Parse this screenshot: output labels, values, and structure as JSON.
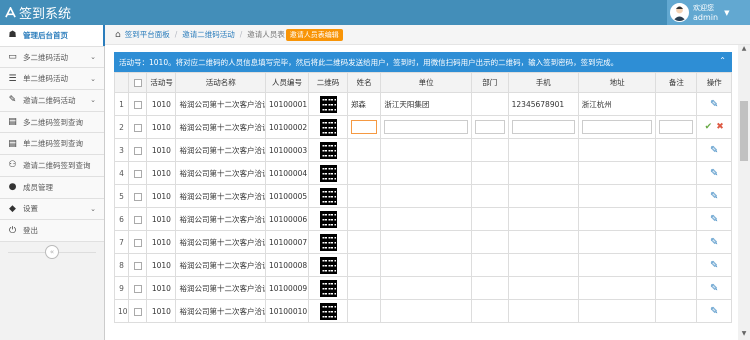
{
  "app": {
    "title": "签到系统",
    "logo_icon": "leaf-icon"
  },
  "user": {
    "greeting": "欢迎您",
    "name": "admin"
  },
  "sidebar": {
    "items": [
      {
        "label": "管理后台首页",
        "icon": "dashboard-icon",
        "active": true
      },
      {
        "label": "多二维码活动",
        "icon": "desktop-icon",
        "has_arrow": true
      },
      {
        "label": "单二维码活动",
        "icon": "list-icon",
        "has_arrow": true
      },
      {
        "label": "邀请二维码活动",
        "icon": "edit-icon",
        "has_arrow": true
      },
      {
        "label": "多二维码签到查询",
        "icon": "list-alt-icon"
      },
      {
        "label": "单二维码签到查询",
        "icon": "list-alt-icon"
      },
      {
        "label": "邀请二维码签到查询",
        "icon": "users-icon"
      },
      {
        "label": "成员管理",
        "icon": "user-icon"
      },
      {
        "label": "设置",
        "icon": "tag-icon",
        "has_arrow": true
      },
      {
        "label": "登出",
        "icon": "power-icon"
      }
    ],
    "collapse_icon": "double-chevron-left-icon"
  },
  "breadcrumb": {
    "items": [
      "签到平台面板",
      "邀请二维码活动",
      "邀请人员表"
    ],
    "tag": "邀请人员表编辑"
  },
  "alert": {
    "text": "活动号：1010。将对应二维码的人员信息填写完毕，然后将此二维码发送给用户，签到时，用微信扫码用户出示的二维码，输入签到密码，签到完成。"
  },
  "table": {
    "headers": [
      "活动号",
      "活动名称",
      "人员编号",
      "二维码",
      "姓名",
      "单位",
      "部门",
      "手机",
      "地址",
      "备注",
      "操作"
    ],
    "rows": [
      {
        "n": "1",
        "activity_id": "1010",
        "activity_name": "裕润公司第十二次客户洽谈会",
        "person_id": "10100001",
        "name": "郑森",
        "unit": "浙江天阳集团",
        "dept": "",
        "phone": "12345678901",
        "address": "浙江杭州",
        "note": "",
        "mode": "view"
      },
      {
        "n": "2",
        "activity_id": "1010",
        "activity_name": "裕润公司第十二次客户洽谈会",
        "person_id": "10100002",
        "name": "",
        "unit": "",
        "dept": "",
        "phone": "",
        "address": "",
        "note": "",
        "mode": "edit"
      },
      {
        "n": "3",
        "activity_id": "1010",
        "activity_name": "裕润公司第十二次客户洽谈会",
        "person_id": "10100003",
        "name": "",
        "unit": "",
        "dept": "",
        "phone": "",
        "address": "",
        "note": "",
        "mode": "view"
      },
      {
        "n": "4",
        "activity_id": "1010",
        "activity_name": "裕润公司第十二次客户洽谈会",
        "person_id": "10100004",
        "name": "",
        "unit": "",
        "dept": "",
        "phone": "",
        "address": "",
        "note": "",
        "mode": "view"
      },
      {
        "n": "5",
        "activity_id": "1010",
        "activity_name": "裕润公司第十二次客户洽谈会",
        "person_id": "10100005",
        "name": "",
        "unit": "",
        "dept": "",
        "phone": "",
        "address": "",
        "note": "",
        "mode": "view"
      },
      {
        "n": "6",
        "activity_id": "1010",
        "activity_name": "裕润公司第十二次客户洽谈会",
        "person_id": "10100006",
        "name": "",
        "unit": "",
        "dept": "",
        "phone": "",
        "address": "",
        "note": "",
        "mode": "view"
      },
      {
        "n": "7",
        "activity_id": "1010",
        "activity_name": "裕润公司第十二次客户洽谈会",
        "person_id": "10100007",
        "name": "",
        "unit": "",
        "dept": "",
        "phone": "",
        "address": "",
        "note": "",
        "mode": "view"
      },
      {
        "n": "8",
        "activity_id": "1010",
        "activity_name": "裕润公司第十二次客户洽谈会",
        "person_id": "10100008",
        "name": "",
        "unit": "",
        "dept": "",
        "phone": "",
        "address": "",
        "note": "",
        "mode": "view"
      },
      {
        "n": "9",
        "activity_id": "1010",
        "activity_name": "裕润公司第十二次客户洽谈会",
        "person_id": "10100009",
        "name": "",
        "unit": "",
        "dept": "",
        "phone": "",
        "address": "",
        "note": "",
        "mode": "view"
      },
      {
        "n": "10",
        "activity_id": "1010",
        "activity_name": "裕润公司第十二次客户洽谈会",
        "person_id": "10100010",
        "name": "",
        "unit": "",
        "dept": "",
        "phone": "",
        "address": "",
        "note": "",
        "mode": "view"
      }
    ]
  },
  "colors": {
    "topbar": "#438eb9",
    "accent": "#2b7dbc",
    "alert": "#2e8ed5",
    "tag": "#f89406"
  }
}
